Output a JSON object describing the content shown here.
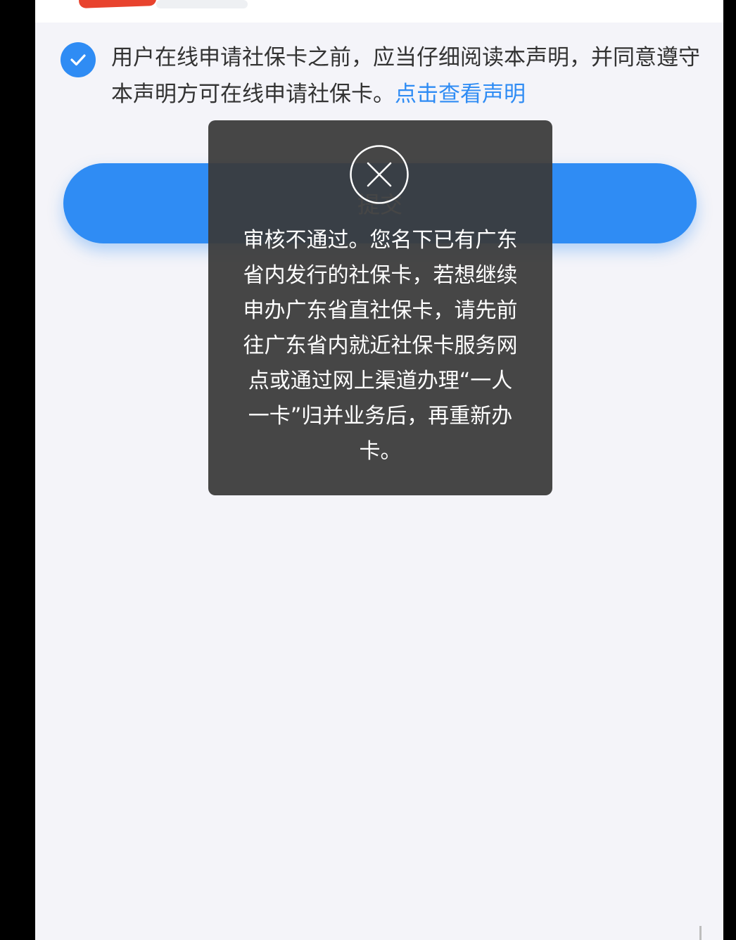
{
  "agreement": {
    "checked": true,
    "text": "用户在线申请社保卡之前，应当仔细阅读本声明，并同意遵守本声明方可在线申请社保卡。",
    "link": "点击查看声明"
  },
  "submit": {
    "label": "提交"
  },
  "toast": {
    "icon": "close-circle-icon",
    "message": "审核不通过。您名下已有广东省内发行的社保卡，若想继续申办广东省直社保卡，请先前往广东省内就近社保卡服务网点或通过网上渠道办理“一人一卡”归并业务后，再重新办卡。"
  },
  "colors": {
    "accent": "#2f8cf4",
    "toast_bg": "#3a3a3a",
    "page_bg": "#f4f4f9"
  }
}
